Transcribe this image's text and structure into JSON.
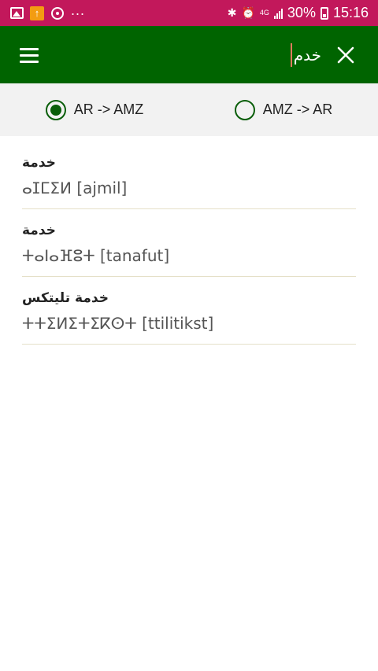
{
  "status_bar": {
    "icons_left": [
      "gallery-icon",
      "app-notification-icon",
      "sync-icon"
    ],
    "more": "...",
    "network": "4G",
    "battery": "30%",
    "time": "15:16"
  },
  "app_bar": {
    "search_value": "خدم",
    "menu_icon": "hamburger-menu-icon",
    "close_icon": "close-icon"
  },
  "direction_toggle": {
    "options": [
      {
        "label": "AR -> AMZ",
        "selected": true
      },
      {
        "label": "AMZ -> AR",
        "selected": false
      }
    ]
  },
  "results": [
    {
      "arabic": "خدمة",
      "amazigh": "ⴰⵊⵎⵉⵍ [ajmil]"
    },
    {
      "arabic": "خدمة",
      "amazigh": "ⵜⴰⵏⴰⴼⵓⵜ [tanafut]"
    },
    {
      "arabic": "خدمة تليتكس",
      "amazigh": "ⵜⵜⵉⵍⵉⵜⵉⴽⵙⵜ [ttilitikst]"
    }
  ],
  "colors": {
    "status_bar": "#c2185b",
    "app_bar": "#006400",
    "accent": "#0a5e0a"
  }
}
